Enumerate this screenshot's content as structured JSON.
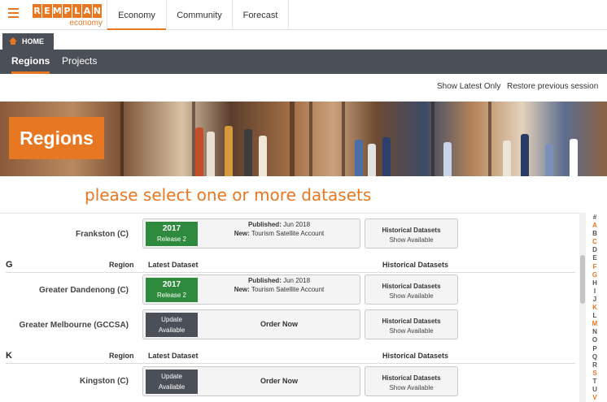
{
  "header": {
    "logo_text": "REMPLAN",
    "logo_sub": "economy",
    "tabs": [
      {
        "label": "Economy"
      },
      {
        "label": "Community"
      },
      {
        "label": "Forecast"
      }
    ]
  },
  "home_tab": {
    "label": "HOME"
  },
  "subnav": {
    "items": [
      {
        "label": "Regions"
      },
      {
        "label": "Projects"
      }
    ]
  },
  "actions": {
    "show_latest": "Show Latest Only",
    "restore": "Restore previous session"
  },
  "banner": {
    "title": "Regions"
  },
  "subtitle": "please select one or more datasets",
  "table_headers": {
    "region": "Region",
    "latest": "Latest Dataset",
    "historical": "Historical Datasets"
  },
  "rows": [
    {
      "region": "Frankston (C)",
      "year": "2017",
      "release": "Release 2",
      "published_label": "Published:",
      "published_date": "Jun 2018",
      "new_label": "New:",
      "new_value": "Tourism Satellite Account",
      "hist_title": "Historical Datasets",
      "hist_sub": "Show Available"
    },
    {
      "region": "Greater Dandenong (C)",
      "year": "2017",
      "release": "Release 2",
      "published_label": "Published:",
      "published_date": "Jun 2018",
      "new_label": "New:",
      "new_value": "Tourism Satellite Account",
      "hist_title": "Historical Datasets",
      "hist_sub": "Show Available"
    },
    {
      "region": "Greater Melbourne (GCCSA)",
      "update_1": "Update",
      "update_2": "Available",
      "order": "Order Now",
      "hist_title": "Historical Datasets",
      "hist_sub": "Show Available"
    },
    {
      "region": "Kingston (C)",
      "update_1": "Update",
      "update_2": "Available",
      "order": "Order Now",
      "hist_title": "Historical Datasets",
      "hist_sub": "Show Available"
    }
  ],
  "sections": [
    {
      "letter": "G"
    },
    {
      "letter": "K"
    }
  ],
  "alphabet": [
    "#",
    "A",
    "B",
    "C",
    "D",
    "E",
    "F",
    "G",
    "H",
    "I",
    "J",
    "K",
    "L",
    "M",
    "N",
    "O",
    "P",
    "Q",
    "R",
    "S",
    "T",
    "U",
    "V"
  ],
  "alphabet_active": [
    "A",
    "C",
    "F",
    "G",
    "K",
    "M",
    "S",
    "V"
  ],
  "colors": {
    "accent": "#e87722",
    "dark": "#4a4f58",
    "green": "#2e8b3e"
  }
}
